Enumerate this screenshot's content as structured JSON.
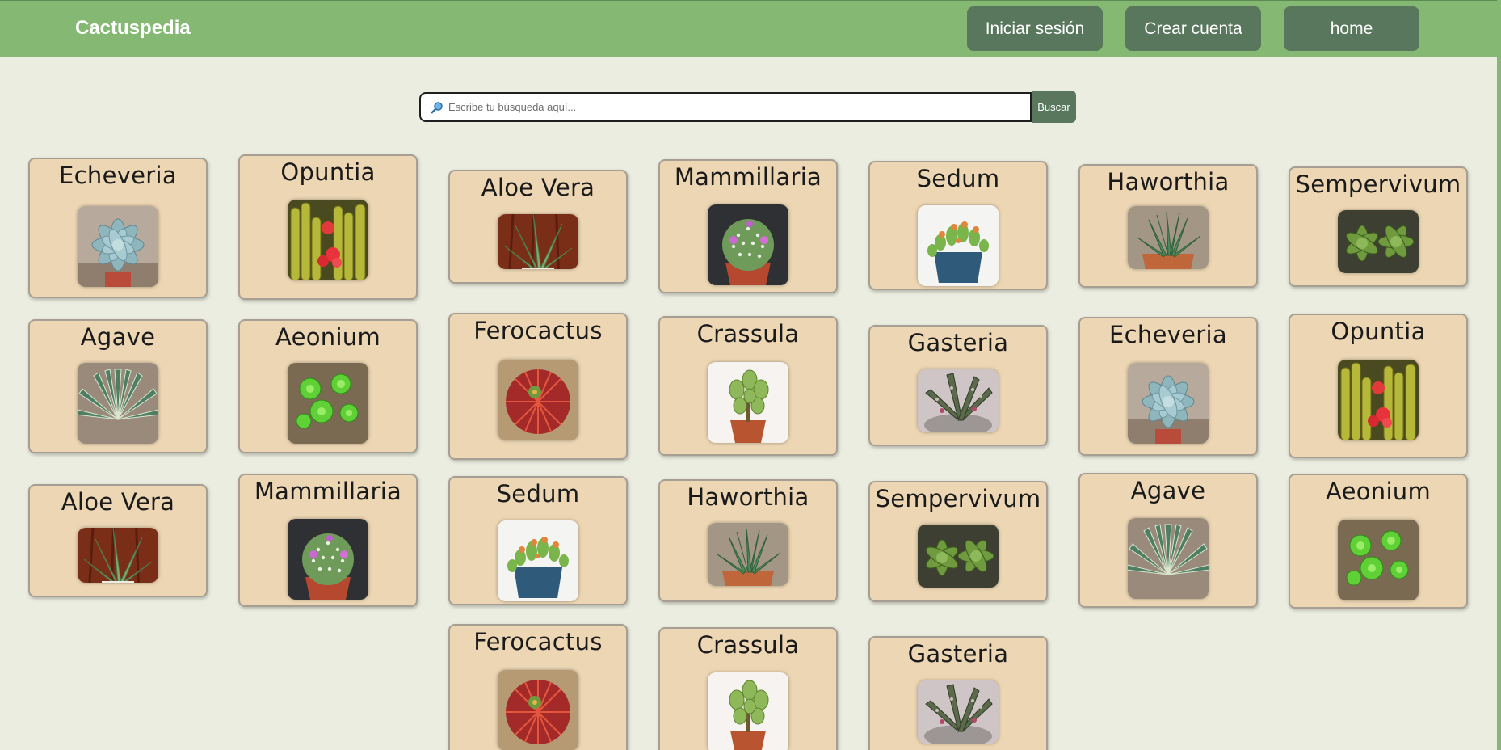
{
  "header": {
    "brand": "Cactuspedia",
    "nav": [
      {
        "label": "Iniciar sesión"
      },
      {
        "label": "Crear cuenta"
      },
      {
        "label": "home"
      }
    ]
  },
  "search": {
    "placeholder": "Escribe tu búsqueda aquí...",
    "value": "",
    "button_label": "Buscar"
  },
  "plants": [
    {
      "name": "Echeveria",
      "image": "echeveria-rosette-icon"
    },
    {
      "name": "Opuntia",
      "image": "opuntia-cactus-icon"
    },
    {
      "name": "Aloe Vera",
      "image": "aloe-vera-icon"
    },
    {
      "name": "Mammillaria",
      "image": "mammillaria-cactus-icon"
    },
    {
      "name": "Sedum",
      "image": "sedum-pot-icon"
    },
    {
      "name": "Haworthia",
      "image": "haworthia-icon"
    },
    {
      "name": "Sempervivum",
      "image": "sempervivum-icon"
    },
    {
      "name": "Agave",
      "image": "agave-icon"
    },
    {
      "name": "Aeonium",
      "image": "aeonium-icon"
    },
    {
      "name": "Ferocactus",
      "image": "ferocactus-icon"
    },
    {
      "name": "Crassula",
      "image": "crassula-icon"
    },
    {
      "name": "Gasteria",
      "image": "gasteria-icon"
    },
    {
      "name": "Echeveria",
      "image": "echeveria-rosette-icon"
    },
    {
      "name": "Opuntia",
      "image": "opuntia-cactus-icon"
    },
    {
      "name": "Aloe Vera",
      "image": "aloe-vera-icon"
    },
    {
      "name": "Mammillaria",
      "image": "mammillaria-cactus-icon"
    },
    {
      "name": "Sedum",
      "image": "sedum-pot-icon"
    },
    {
      "name": "Haworthia",
      "image": "haworthia-icon"
    },
    {
      "name": "Sempervivum",
      "image": "sempervivum-icon"
    },
    {
      "name": "Agave",
      "image": "agave-icon"
    },
    {
      "name": "Aeonium",
      "image": "aeonium-icon"
    },
    {
      "name": "Ferocactus",
      "image": "ferocactus-icon"
    },
    {
      "name": "Crassula",
      "image": "crassula-icon"
    },
    {
      "name": "Gasteria",
      "image": "gasteria-icon"
    }
  ],
  "colors": {
    "header": "#84b873",
    "button": "#58775c",
    "card": "#ecd6b3",
    "page": "#ebede0"
  }
}
